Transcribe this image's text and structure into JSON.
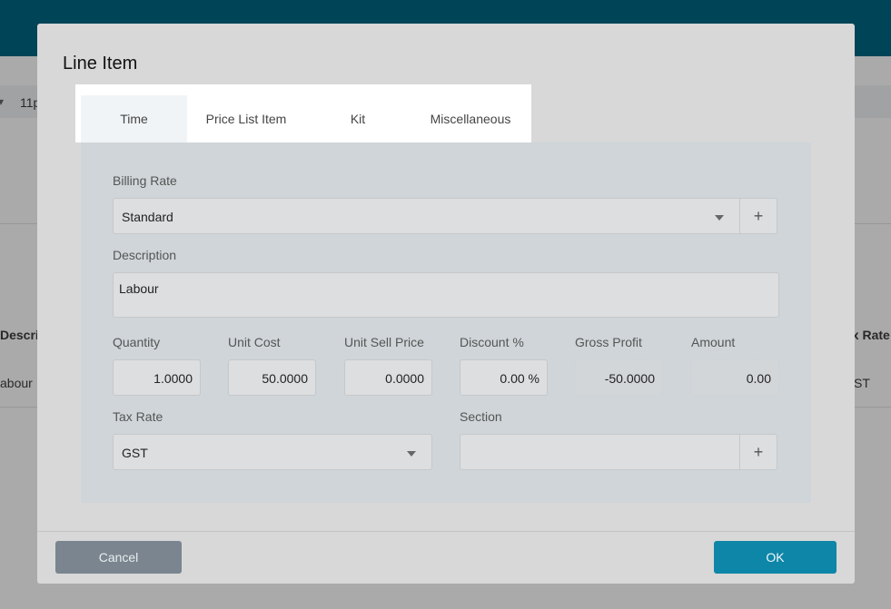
{
  "background": {
    "fragment_row_label": "11p",
    "header_description": "Descript",
    "header_tax_rate": "ax Rate",
    "row_description": "abour",
    "row_tax": "ST"
  },
  "modal": {
    "title": "Line Item",
    "tabs": [
      {
        "label": "Time",
        "active": true
      },
      {
        "label": "Price List Item",
        "active": false
      },
      {
        "label": "Kit",
        "active": false
      },
      {
        "label": "Miscellaneous",
        "active": false
      }
    ],
    "form": {
      "billing_rate_label": "Billing Rate",
      "billing_rate_value": "Standard",
      "description_label": "Description",
      "description_value": "Labour",
      "quantity_label": "Quantity",
      "quantity_value": "1.0000",
      "unit_cost_label": "Unit Cost",
      "unit_cost_value": "50.0000",
      "unit_sell_price_label": "Unit Sell Price",
      "unit_sell_price_value": "0.0000",
      "discount_label": "Discount %",
      "discount_value": "0.00 %",
      "gross_profit_label": "Gross Profit",
      "gross_profit_value": "-50.0000",
      "amount_label": "Amount",
      "amount_value": "0.00",
      "tax_rate_label": "Tax Rate",
      "tax_rate_value": "GST",
      "section_label": "Section",
      "section_value": "",
      "add_symbol": "+"
    },
    "footer": {
      "cancel_label": "Cancel",
      "ok_label": "OK"
    }
  },
  "colors": {
    "topbar": "#00566e",
    "ok_button": "#0e86a8",
    "cancel_button": "#7a858f"
  },
  "icons": {
    "dropdown": "caret-down-icon",
    "add": "plus-icon"
  }
}
